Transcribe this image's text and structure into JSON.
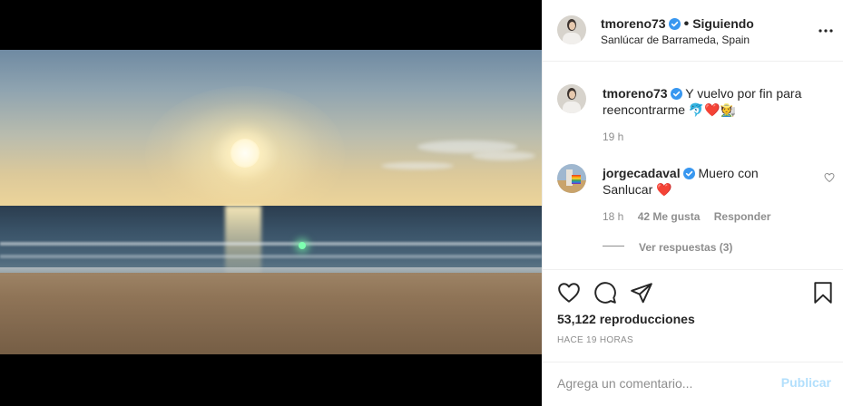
{
  "post": {
    "author": "tmoreno73",
    "separator": "•",
    "follow_status": "Siguiendo",
    "location": "Sanlúcar de Barrameda, Spain",
    "more_icon": "more-horizontal-icon"
  },
  "caption": {
    "username": "tmoreno73",
    "text": "Y vuelvo por fin para reencontrarme 🐬❤️🧑‍🌾",
    "time": "19 h"
  },
  "comments": [
    {
      "username": "jorgecadaval",
      "text": "Muero con Sanlucar ❤️",
      "time": "18 h",
      "likes": "42 Me gusta",
      "reply_label": "Responder",
      "view_replies": "Ver respuestas (3)"
    }
  ],
  "actions": {
    "icons": [
      "heart-icon",
      "comment-icon",
      "share-icon",
      "bookmark-icon"
    ],
    "views": "53,122 reproducciones",
    "time_ago": "HACE 19 HORAS"
  },
  "add_comment": {
    "placeholder": "Agrega un comentario...",
    "publish_label": "Publicar"
  },
  "colors": {
    "verified": "#3897f0",
    "publish_disabled": "#b2dffc",
    "muted": "#8e8e8e",
    "heart": "#e0245e"
  }
}
